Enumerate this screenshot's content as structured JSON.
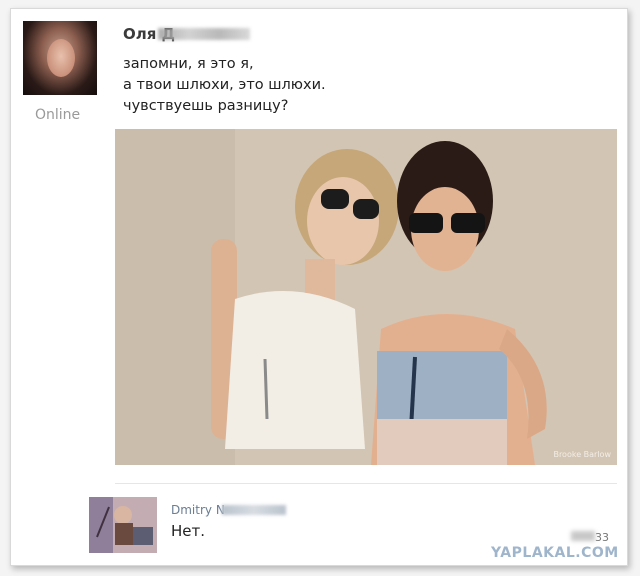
{
  "post": {
    "author_name": "Оля Д",
    "status": "Online",
    "message_lines": [
      "запомни, я это я,",
      "а твои шлюхи, это шлюхи.",
      "чувствуешь разницу?"
    ],
    "photo_caption": "Brooke Barlow"
  },
  "reply": {
    "author_name": "Dmitry N",
    "text": "Нет.",
    "count": "33"
  },
  "watermark": "YAPLAKAL.COM",
  "colors": {
    "background": "#ffffff",
    "status": "#9a9a9a",
    "reply_author": "#6a7d93",
    "watermark": "#9fb5cc"
  },
  "icons": {
    "post_avatar": "user-photo-avatar",
    "reply_avatar": "cartoon-avatar"
  }
}
